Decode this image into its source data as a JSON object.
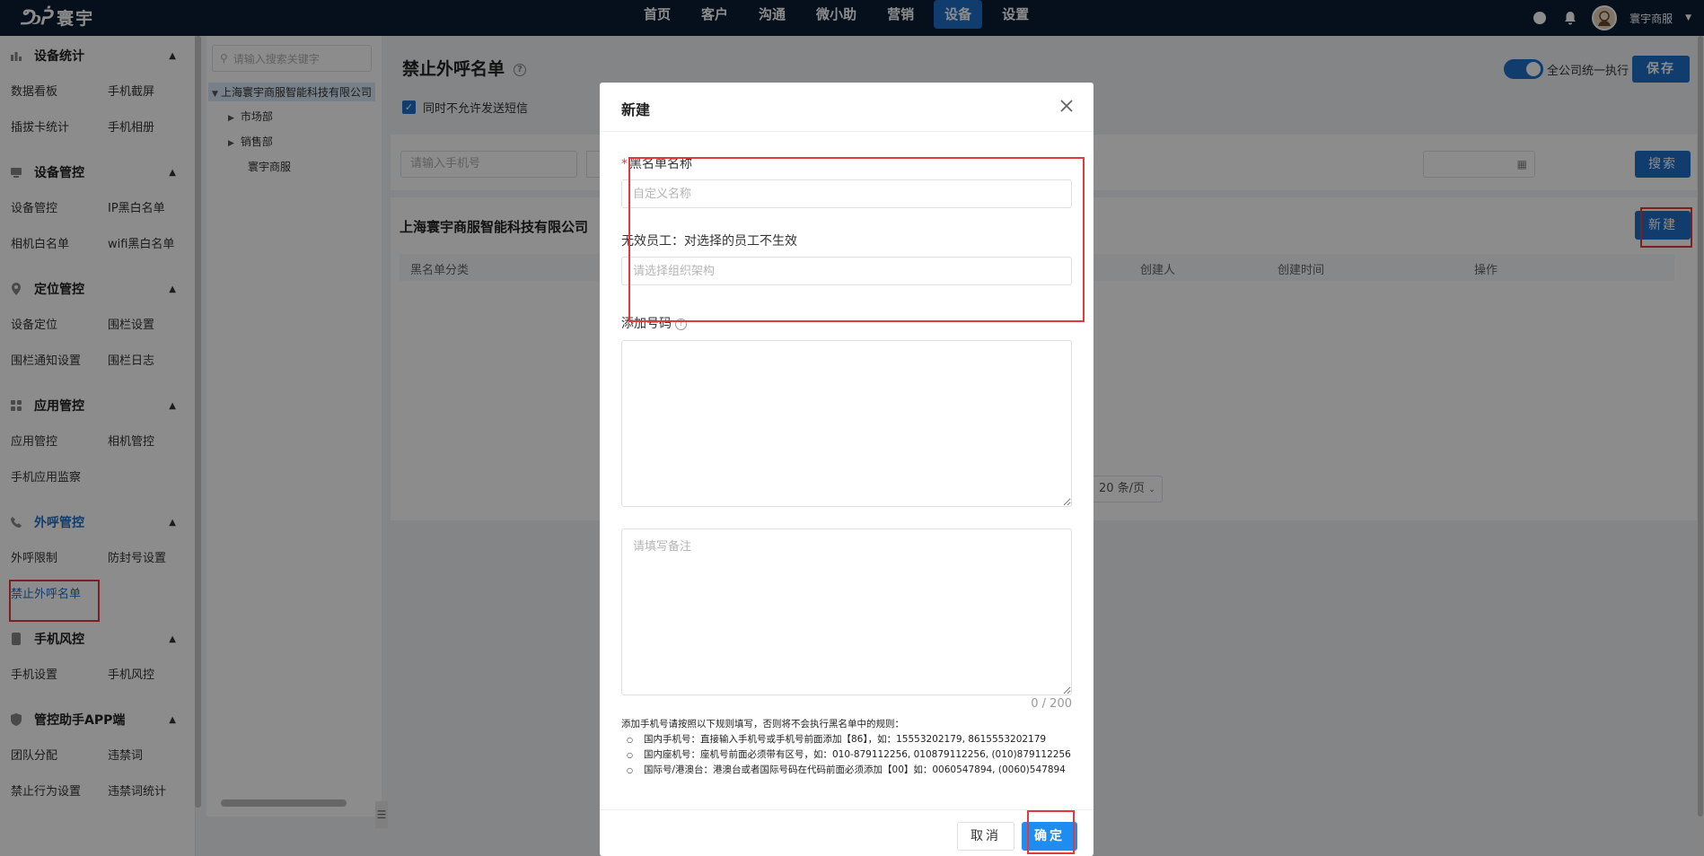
{
  "app": {
    "logo_mark": "ᕤↄᕉ",
    "logo_text": "寰宇",
    "nav": [
      "首页",
      "客户",
      "沟通",
      "微小助",
      "营销",
      "设备",
      "设置"
    ],
    "nav_active": "设备",
    "user_name": "寰宇商服"
  },
  "sidebar": {
    "groups": [
      {
        "title": "设备统计",
        "icon": "bar-chart-icon",
        "items": [
          "数据看板",
          "手机截屏",
          "插拔卡统计",
          "手机相册"
        ]
      },
      {
        "title": "设备管控",
        "icon": "device-icon",
        "items": [
          "设备管控",
          "IP黑白名单",
          "相机白名单",
          "wifi黑白名单"
        ]
      },
      {
        "title": "定位管控",
        "icon": "location-icon",
        "items": [
          "设备定位",
          "围栏设置",
          "围栏通知设置",
          "围栏日志"
        ]
      },
      {
        "title": "应用管控",
        "icon": "apps-icon",
        "items": [
          "应用管控",
          "相机管控",
          "手机应用监察"
        ]
      },
      {
        "title": "外呼管控",
        "icon": "phone-icon",
        "items": [
          "外呼限制",
          "防封号设置",
          "禁止外呼名单"
        ]
      },
      {
        "title": "手机风控",
        "icon": "mobile-icon",
        "items": [
          "手机设置",
          "手机风控"
        ]
      },
      {
        "title": "管控助手APP端",
        "icon": "shield-icon",
        "items": [
          "团队分配",
          "违禁词",
          "禁止行为设置",
          "违禁词统计"
        ]
      }
    ],
    "active_item": "禁止外呼名单"
  },
  "tree": {
    "search_placeholder": "请输入搜索关键字",
    "root": "上海寰宇商服智能科技有限公司",
    "children": [
      "市场部",
      "销售部",
      "寰宇商服"
    ]
  },
  "page": {
    "title": "禁止外呼名单",
    "checkbox_label": "同时不允许发送短信",
    "toggle_label": "全公司统一执行",
    "save_button": "保存",
    "phone_placeholder": "请输入手机号",
    "search_button": "搜索",
    "card_title": "上海寰宇商服智能科技有限公司",
    "new_button": "新建",
    "table_headers": [
      "黑名单分类",
      "创建人",
      "创建时间",
      "操作"
    ],
    "page_size": "20 条/页"
  },
  "modal": {
    "title": "新建",
    "name_label": "黑名单名称",
    "name_placeholder": "自定义名称",
    "exempt_label": "无效员工：对选择的员工不生效",
    "exempt_placeholder": "请选择组织架构",
    "numbers_label": "添加号码",
    "remark_placeholder": "请填写备注",
    "counter": "0 / 200",
    "rules_intro": "添加手机号请按照以下规则填写，否则将不会执行黑名单中的规则：",
    "rules": [
      "国内手机号：直接输入手机号或手机号前面添加【86】，如：15553202179, 8615553202179",
      "国内座机号：座机号前面必须带有区号，如：010-879112256, 010879112256, (010)879112256",
      "国际号/港澳台：港澳台或者国际号码在代码前面必须添加【00】如：0060547894, (0060)547894"
    ],
    "cancel_button": "取消",
    "ok_button": "确定"
  },
  "colors": {
    "topbar": "#0c1c33",
    "accent": "#1f6ec9",
    "annotation_red": "#e0393e"
  }
}
